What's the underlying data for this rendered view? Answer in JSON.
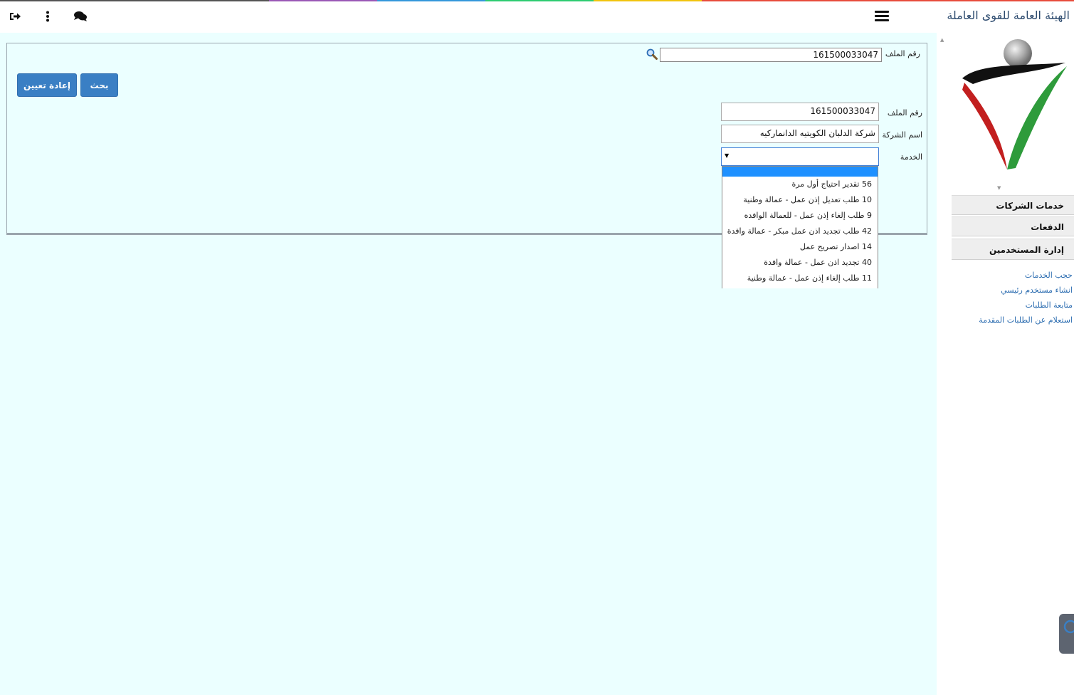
{
  "header": {
    "site_title": "الهيئة العامة للقوى العاملة",
    "icons": [
      "logout-icon",
      "more-vertical-icon",
      "chat-icon",
      "hamburger-menu-icon"
    ]
  },
  "search": {
    "file_label": "رقم الملف",
    "file_value": "161500033047",
    "search_button": "بحث",
    "reset_button": "إعادة تعيين"
  },
  "form": {
    "file_label": "رقم الملف",
    "file_value": "161500033047",
    "company_label": "اسم الشركة",
    "company_value": "شركة الدلبان الكويتيه الدانماركيه",
    "service_label": "الخدمة",
    "service_value": ""
  },
  "service_options": [
    "",
    "56 تقدير احتياج أول مرة",
    "10 طلب تعديل إذن عمل - عمالة وطنية",
    "9 طلب إلغاء إذن عمل - للعمالة الوافده",
    "42 طلب تجديد اذن عمل مبكر - عمالة وافدة",
    "14 اصدار تصريح عمل",
    "40 تجديد اذن عمل - عمالة وافدة",
    "11 طلب إلغاء إذن عمل - عمالة وطنية"
  ],
  "sidebar": {
    "menu": [
      {
        "label": "خدمات الشركات"
      },
      {
        "label": "الدفعات"
      },
      {
        "label": "إدارة المستخدمين"
      }
    ],
    "links": [
      {
        "label": "حجب الخدمات"
      },
      {
        "label": "انشاء مستخدم رئيسي"
      },
      {
        "label": "متابعة الطلبات"
      },
      {
        "label": "استعلام عن الطلبات المقدمة"
      }
    ]
  },
  "colors": {
    "page_bg": "#ebffff",
    "button": "#3a7fc4",
    "link": "#2b6cb0",
    "selected_option": "#1e90ff"
  }
}
